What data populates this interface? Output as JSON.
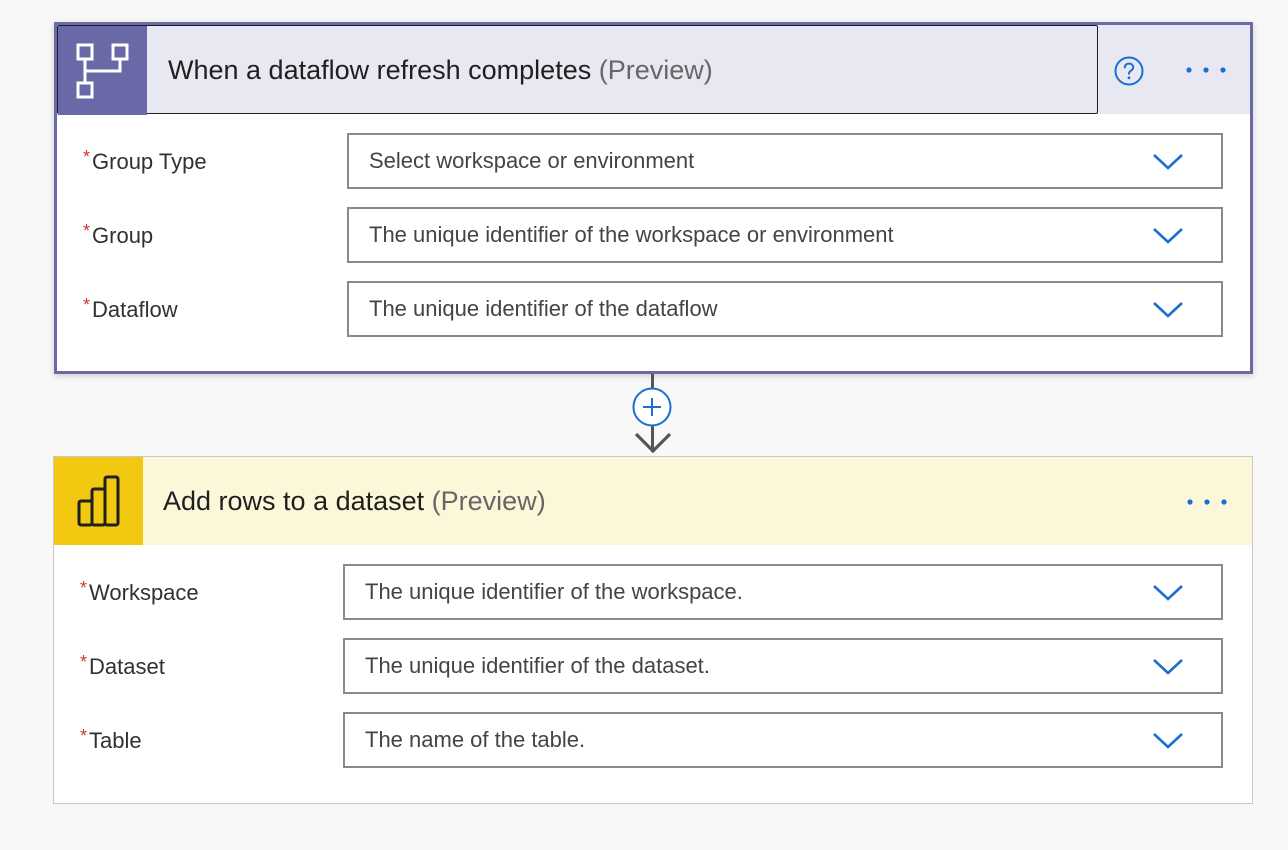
{
  "trigger": {
    "icon": "dataflow-icon",
    "title": "When a dataflow refresh completes",
    "preview": "(Preview)",
    "help_icon": "help-icon",
    "more_icon": "more-options-icon",
    "accent_color": "#6a69a8",
    "fields": [
      {
        "label": "Group Type",
        "placeholder": "Select workspace or environment",
        "required": true
      },
      {
        "label": "Group",
        "placeholder": "The unique identifier of the workspace or environment",
        "required": true
      },
      {
        "label": "Dataflow",
        "placeholder": "The unique identifier of the dataflow",
        "required": true
      }
    ]
  },
  "connector": {
    "add_icon": "plus-circle-icon",
    "arrow_icon": "arrow-down-icon"
  },
  "action": {
    "icon": "power-bi-icon",
    "title": "Add rows to a dataset",
    "preview": "(Preview)",
    "more_icon": "more-options-icon",
    "accent_color": "#f2c811",
    "fields": [
      {
        "label": "Workspace",
        "placeholder": "The unique identifier of the workspace.",
        "required": true
      },
      {
        "label": "Dataset",
        "placeholder": "The unique identifier of the dataset.",
        "required": true
      },
      {
        "label": "Table",
        "placeholder": "The name of the table.",
        "required": true
      }
    ]
  },
  "required_marker": "*"
}
